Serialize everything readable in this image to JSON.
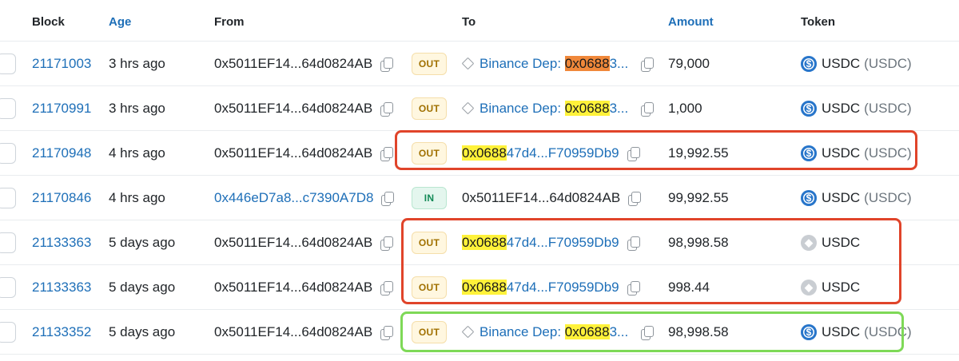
{
  "header": {
    "block": "Block",
    "age": "Age",
    "from": "From",
    "to": "To",
    "amount": "Amount",
    "token": "Token"
  },
  "colors": {
    "link": "#1e6fb8",
    "out_badge": "#fff7e0",
    "in_badge": "#e4f6ee",
    "highlight_yellow": "#fff23a",
    "highlight_orange": "#f0883a",
    "annotation_red": "#e0442a",
    "annotation_green": "#7ed957",
    "usdc_blue": "#2775ca"
  },
  "rows": [
    {
      "block": "21171003",
      "age": "3 hrs ago",
      "from": "0x5011EF14...64d0824AB",
      "direction": "OUT",
      "to": {
        "dep_label": "Binance Dep: ",
        "highlight": "0x0688",
        "rest": "3..."
      },
      "amount": "79,000",
      "token": {
        "icon": "usdc-icon",
        "name": "USDC",
        "sub": "(USDC)"
      }
    },
    {
      "block": "21170991",
      "age": "3 hrs ago",
      "from": "0x5011EF14...64d0824AB",
      "direction": "OUT",
      "to": {
        "dep_label": "Binance Dep: ",
        "highlight": "0x0688",
        "rest": "3..."
      },
      "amount": "1,000",
      "token": {
        "icon": "usdc-icon",
        "name": "USDC",
        "sub": "(USDC)"
      }
    },
    {
      "block": "21170948",
      "age": "4 hrs ago",
      "from": "0x5011EF14...64d0824AB",
      "direction": "OUT",
      "to": {
        "highlight": "0x0688",
        "rest": "47d4...F70959Db9"
      },
      "amount": "19,992.55",
      "token": {
        "icon": "usdc-icon",
        "name": "USDC",
        "sub": "(USDC)"
      }
    },
    {
      "block": "21170846",
      "age": "4 hrs ago",
      "from": "0x446eD7a8...c7390A7D8",
      "direction": "IN",
      "to": {
        "text": "0x5011EF14...64d0824AB"
      },
      "amount": "99,992.55",
      "token": {
        "icon": "usdc-icon",
        "name": "USDC",
        "sub": "(USDC)"
      }
    },
    {
      "block": "21133363",
      "age": "5 days ago",
      "from": "0x5011EF14...64d0824AB",
      "direction": "OUT",
      "to": {
        "highlight": "0x0688",
        "rest": "47d4...F70959Db9"
      },
      "amount": "98,998.58",
      "token": {
        "icon": "eth-icon",
        "name": "USDC"
      }
    },
    {
      "block": "21133363",
      "age": "5 days ago",
      "from": "0x5011EF14...64d0824AB",
      "direction": "OUT",
      "to": {
        "highlight": "0x0688",
        "rest": "47d4...F70959Db9"
      },
      "amount": "998.44",
      "token": {
        "icon": "eth-icon",
        "name": "USDC"
      }
    },
    {
      "block": "21133352",
      "age": "5 days ago",
      "from": "0x5011EF14...64d0824AB",
      "direction": "OUT",
      "to": {
        "dep_label": "Binance Dep: ",
        "highlight": "0x0688",
        "rest": "3..."
      },
      "amount": "98,998.58",
      "token": {
        "icon": "usdc-icon",
        "name": "USDC",
        "sub": "(USDC)"
      }
    }
  ]
}
